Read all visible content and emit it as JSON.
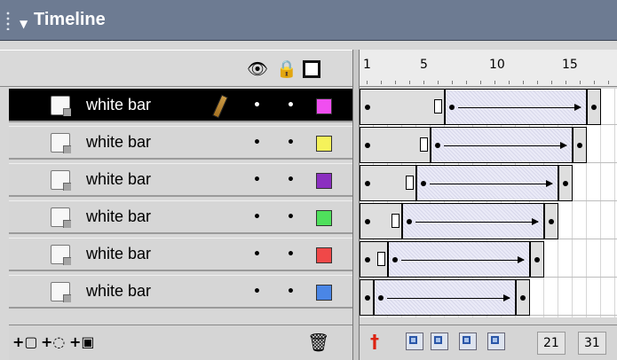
{
  "window": {
    "title": "Timeline",
    "collapse_arrow": "▼"
  },
  "layer_header": {
    "icons": {
      "eye": "eye-icon",
      "lock": "lock-icon",
      "outline": "outline-icon"
    },
    "eye_glyph": "👁",
    "lock_glyph": "🔒"
  },
  "layers": [
    {
      "name": "white bar",
      "color": "#f04ef0",
      "selected": true
    },
    {
      "name": "white bar",
      "color": "#f5f25a",
      "selected": false
    },
    {
      "name": "white bar",
      "color": "#8b2fc0",
      "selected": false
    },
    {
      "name": "white bar",
      "color": "#4fe05c",
      "selected": false
    },
    {
      "name": "white bar",
      "color": "#f04848",
      "selected": false
    },
    {
      "name": "white bar",
      "color": "#4a86e6",
      "selected": false
    }
  ],
  "dot": "•",
  "ruler": {
    "labels": [
      "1",
      "5",
      "10",
      "15"
    ]
  },
  "frames": [
    {
      "blank_to": 5,
      "hold_at": 6,
      "tween_to": 16
    },
    {
      "blank_to": 4,
      "hold_at": 5,
      "tween_to": 15
    },
    {
      "blank_to": 3,
      "hold_at": 4,
      "tween_to": 14
    },
    {
      "blank_to": 2,
      "hold_at": 3,
      "tween_to": 13
    },
    {
      "blank_to": 1,
      "hold_at": 2,
      "tween_to": 12
    },
    {
      "blank_to": 0,
      "hold_at": 1,
      "tween_to": 11
    }
  ],
  "layer_footer": {
    "insert_layer_glyph": "+▢",
    "motion_guide_glyph": "+◌",
    "insert_folder_glyph": "+▣",
    "trash_glyph": "🗑"
  },
  "timeline_footer": {
    "playhead_glyph": "†",
    "current_frame": "21",
    "frame_rate": "31"
  }
}
